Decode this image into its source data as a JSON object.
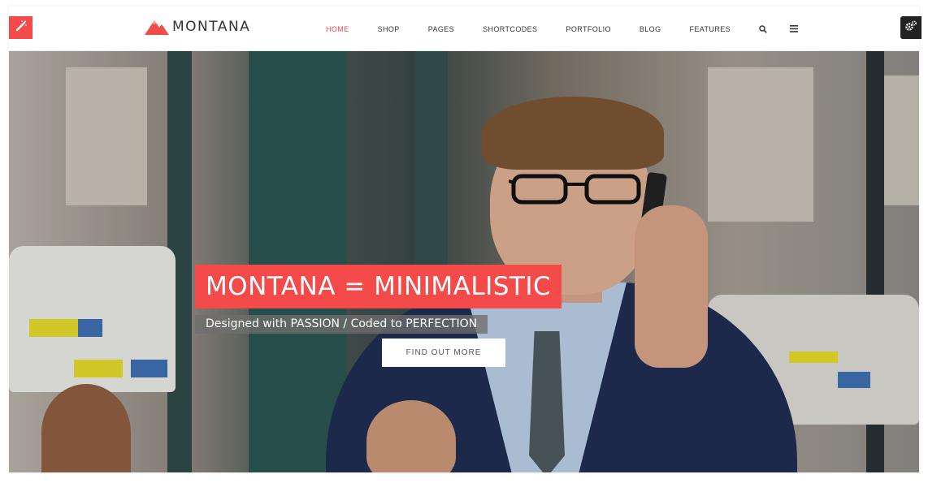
{
  "brand": {
    "name": "MONTANA",
    "accent": "#f44a4a"
  },
  "nav": {
    "items": [
      {
        "label": "HOME",
        "active": true
      },
      {
        "label": "SHOP",
        "active": false
      },
      {
        "label": "PAGES",
        "active": false
      },
      {
        "label": "SHORTCODES",
        "active": false
      },
      {
        "label": "PORTFOLIO",
        "active": false
      },
      {
        "label": "BLOG",
        "active": false
      },
      {
        "label": "FEATURES",
        "active": false
      }
    ],
    "icons": [
      "search-icon",
      "menu-icon"
    ]
  },
  "side_tabs": {
    "left_icon": "magic-wand-icon",
    "right_icon": "gears-icon"
  },
  "hero": {
    "title": "MONTANA = MINIMALISTIC",
    "subtitle": "Designed with PASSION / Coded to PERFECTION",
    "button_label": "FIND OUT MORE"
  }
}
